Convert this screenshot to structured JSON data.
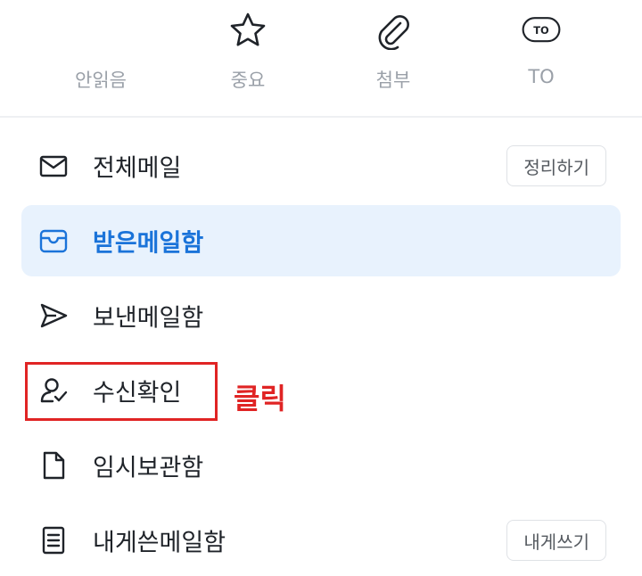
{
  "filters": {
    "unread": {
      "label": "안읽음",
      "icon": "unread-icon"
    },
    "important": {
      "label": "중요",
      "icon": "star-icon"
    },
    "attachment": {
      "label": "첨부",
      "icon": "paperclip-icon"
    },
    "to": {
      "label": "TO",
      "badge": "TO",
      "icon": "to-badge-icon"
    }
  },
  "menu": {
    "all_mail": {
      "label": "전체메일",
      "icon": "envelope-icon",
      "button": "정리하기"
    },
    "inbox": {
      "label": "받은메일함",
      "icon": "inbox-icon",
      "active": true
    },
    "sent": {
      "label": "보낸메일함",
      "icon": "send-icon"
    },
    "read_receipt": {
      "label": "수신확인",
      "icon": "person-check-icon"
    },
    "drafts": {
      "label": "임시보관함",
      "icon": "document-icon"
    },
    "to_me": {
      "label": "내게쓴메일함",
      "icon": "note-icon",
      "button": "내게쓰기"
    }
  },
  "annotation": {
    "text": "클릭",
    "color": "#e02424"
  },
  "colors": {
    "accent": "#1a73d9",
    "active_bg": "#e8f2fd",
    "text": "#1f2329",
    "muted": "#9aa0a8"
  }
}
